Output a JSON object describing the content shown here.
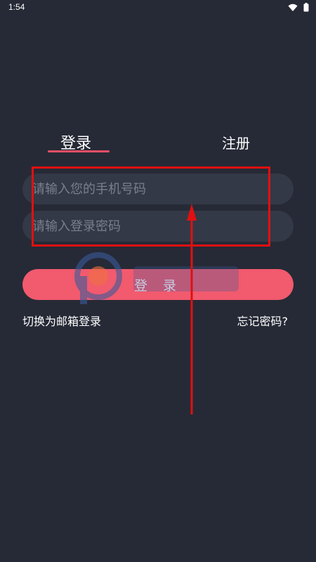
{
  "status_bar": {
    "time": "1:54"
  },
  "tabs": {
    "login": "登录",
    "register": "注册"
  },
  "phone_input": {
    "placeholder": "请输入您的手机号码"
  },
  "password_input": {
    "placeholder": "请输入登录密码"
  },
  "login_button": {
    "label": "登 录"
  },
  "links": {
    "switch_email": "切换为邮箱登录",
    "forgot_password": "忘记密码?"
  },
  "colors": {
    "background": "#262a36",
    "accent": "#f04e66",
    "input_bg": "#343947",
    "annotation": "#e01010"
  }
}
